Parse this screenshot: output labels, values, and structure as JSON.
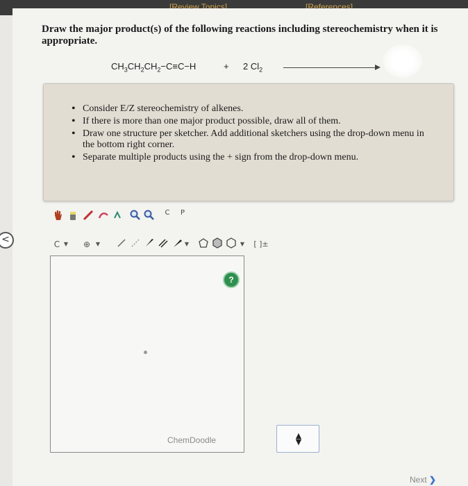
{
  "topbar": {
    "review_topics": "[Review Topics]",
    "references": "[References]"
  },
  "question": "Draw the major product(s) of the following reactions including stereochemistry when it is appropriate.",
  "reaction": {
    "reactant_parts": [
      "CH",
      "3",
      "CH",
      "2",
      "CH",
      "2",
      "−C≡C−H"
    ],
    "plus": "+",
    "reagent": "2 Cl",
    "reagent_sub": "2"
  },
  "hints": [
    "Consider E/Z stereochemistry of alkenes.",
    "If there is more than one major product possible, draw all of them.",
    "Draw one structure per sketcher. Add additional sketchers using the drop-down menu in the bottom right corner.",
    "Separate multiple products using the + sign from the drop-down menu."
  ],
  "toolbar1": [
    "hand-tool-icon",
    "eraser-icon",
    "pencil-icon",
    "lasso-icon",
    "zoom-in-icon",
    "zoom-out-icon",
    "copy-icon",
    "paste-icon"
  ],
  "toolbar_labels": {
    "copy": "C",
    "paste": "P"
  },
  "toolbar2": {
    "element": "C",
    "charge": "⊕",
    "bond_buttons": [
      "single-bond-icon",
      "stereo-bond-icon",
      "wedge-bond-icon",
      "double-bond-icon",
      "triple-bond-icon"
    ],
    "ring_buttons": [
      "cyclopentane-icon",
      "hexagon-filled-icon",
      "hexagon-icon"
    ],
    "bracket": "[ ]±"
  },
  "canvas": {
    "help": "?",
    "watermark": "ChemDoodle"
  },
  "nav": {
    "next": "Next",
    "next_chevron": "❯",
    "back": "<"
  }
}
